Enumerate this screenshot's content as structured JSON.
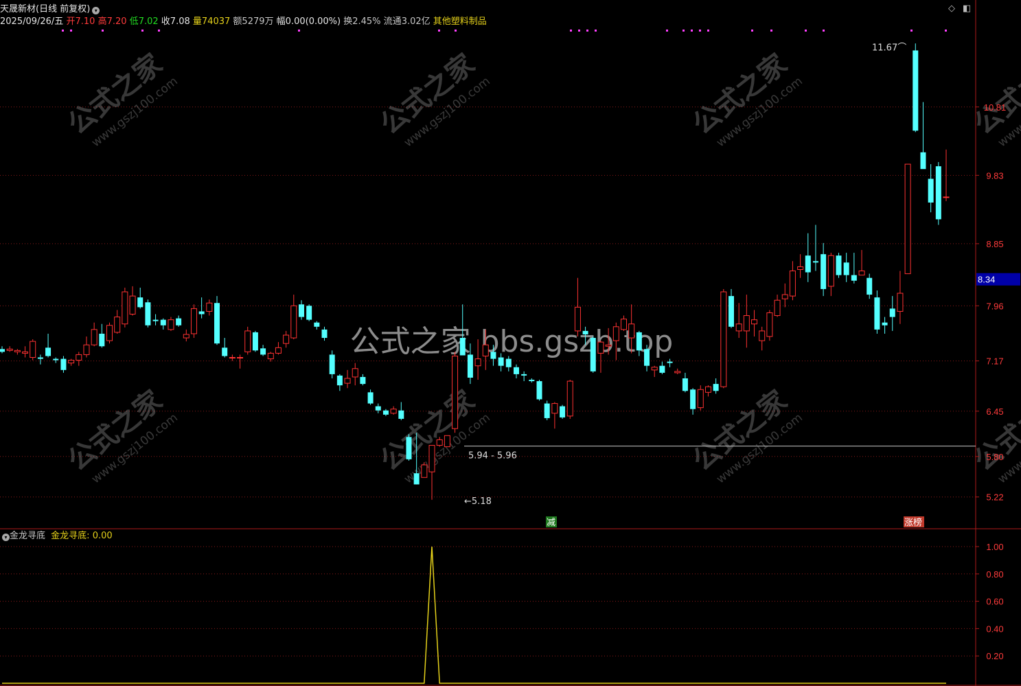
{
  "header": {
    "stock_name": "天晟新材",
    "period_label": "(日线 前复权)",
    "date": "2025/09/26/五",
    "open_label": "开",
    "open": "7.10",
    "high_label": "高",
    "high": "7.20",
    "low_label": "低",
    "low": "7.02",
    "close_label": "收",
    "close": "7.08",
    "volume_label": "量",
    "volume": "74037",
    "amount_label": "额",
    "amount": "5279万",
    "change_label": "幅",
    "change": "0.00(0.00%)",
    "turnover_label": "换",
    "turnover": "2.45%",
    "float_label": "流通",
    "float": "3.02亿",
    "sector": "其他塑料制品"
  },
  "indicator": {
    "name": "金龙寻底",
    "line_label": "金龙寻底:",
    "value": "0.00"
  },
  "watermark": {
    "center": "公式之家 bbs.gszb.top",
    "diag_cn": "公式之家",
    "diag_url": "www.gszj100.com"
  },
  "colors": {
    "up": "#ff3232",
    "down": "#54ffff",
    "grid": "#8b1a1a",
    "indicator_line": "#e6d21a",
    "price_tag_bg": "#0000a8"
  },
  "chart_data": [
    {
      "type": "candlestick",
      "title": "",
      "y_ticks": [
        10.81,
        9.83,
        8.85,
        7.96,
        7.17,
        6.45,
        5.8,
        5.22
      ],
      "y_tick_labels": [
        "10.81",
        "9.83",
        "8.85",
        "7.96",
        "7.17",
        "6.45",
        "5.80",
        "5.22"
      ],
      "current_price_tag": "8.34",
      "ylim": [
        5.05,
        11.9
      ],
      "grid": true,
      "candles": [
        [
          7.34,
          7.38,
          7.28,
          7.3
        ],
        [
          7.32,
          7.38,
          7.3,
          7.34
        ],
        [
          7.3,
          7.34,
          7.26,
          7.32
        ],
        [
          7.28,
          7.38,
          7.22,
          7.3
        ],
        [
          7.22,
          7.48,
          7.18,
          7.45
        ],
        [
          7.22,
          7.26,
          7.12,
          7.2
        ],
        [
          7.36,
          7.56,
          7.22,
          7.24
        ],
        [
          7.2,
          7.22,
          7.14,
          7.18
        ],
        [
          7.2,
          7.24,
          7.0,
          7.04
        ],
        [
          7.14,
          7.2,
          7.1,
          7.18
        ],
        [
          7.18,
          7.3,
          7.1,
          7.26
        ],
        [
          7.26,
          7.52,
          7.22,
          7.4
        ],
        [
          7.4,
          7.72,
          7.38,
          7.62
        ],
        [
          7.56,
          7.7,
          7.36,
          7.38
        ],
        [
          7.46,
          7.72,
          7.42,
          7.68
        ],
        [
          7.58,
          7.9,
          7.56,
          7.8
        ],
        [
          7.7,
          8.22,
          7.65,
          8.16
        ],
        [
          7.84,
          8.24,
          7.82,
          8.1
        ],
        [
          8.08,
          8.22,
          7.92,
          7.94
        ],
        [
          8.01,
          8.05,
          7.65,
          7.68
        ],
        [
          7.76,
          7.84,
          7.68,
          7.74
        ],
        [
          7.76,
          7.78,
          7.62,
          7.68
        ],
        [
          7.62,
          7.8,
          7.6,
          7.76
        ],
        [
          7.78,
          7.82,
          7.66,
          7.68
        ],
        [
          7.5,
          7.62,
          7.45,
          7.55
        ],
        [
          7.56,
          7.98,
          7.5,
          7.92
        ],
        [
          7.88,
          8.08,
          7.78,
          7.84
        ],
        [
          7.88,
          8.05,
          7.82,
          8.0
        ],
        [
          8.0,
          8.1,
          7.4,
          7.42
        ],
        [
          7.36,
          7.5,
          7.22,
          7.24
        ],
        [
          7.22,
          7.26,
          7.17,
          7.22
        ],
        [
          7.22,
          7.26,
          7.06,
          7.22
        ],
        [
          7.3,
          7.66,
          7.26,
          7.6
        ],
        [
          7.58,
          7.6,
          7.3,
          7.32
        ],
        [
          7.35,
          7.4,
          7.24,
          7.26
        ],
        [
          7.2,
          7.3,
          7.16,
          7.28
        ],
        [
          7.28,
          7.44,
          7.26,
          7.36
        ],
        [
          7.42,
          7.6,
          7.36,
          7.54
        ],
        [
          7.5,
          8.12,
          7.48,
          7.96
        ],
        [
          7.98,
          8.04,
          7.76,
          7.8
        ],
        [
          7.96,
          7.98,
          7.74,
          7.76
        ],
        [
          7.72,
          7.74,
          7.62,
          7.66
        ],
        [
          7.62,
          7.66,
          7.46,
          7.5
        ],
        [
          7.26,
          7.32,
          6.92,
          6.98
        ],
        [
          6.96,
          6.98,
          6.74,
          6.82
        ],
        [
          6.85,
          7.04,
          6.78,
          6.92
        ],
        [
          6.94,
          7.14,
          6.82,
          7.06
        ],
        [
          6.94,
          6.98,
          6.82,
          6.84
        ],
        [
          6.72,
          6.76,
          6.54,
          6.56
        ],
        [
          6.52,
          6.56,
          6.42,
          6.46
        ],
        [
          6.46,
          6.48,
          6.38,
          6.4
        ],
        [
          6.42,
          6.52,
          6.4,
          6.48
        ],
        [
          6.46,
          6.58,
          6.32,
          6.34
        ],
        [
          6.08,
          6.12,
          5.74,
          5.76
        ],
        [
          5.56,
          6.14,
          5.4,
          5.4
        ],
        [
          5.5,
          5.72,
          5.5,
          5.68
        ],
        [
          5.58,
          5.92,
          5.18,
          5.96
        ],
        [
          5.96,
          6.08,
          5.94,
          6.04
        ],
        [
          5.94,
          6.1,
          5.94,
          6.1
        ],
        [
          6.2,
          7.3,
          6.14,
          7.24
        ],
        [
          7.5,
          7.98,
          7.48,
          7.25
        ],
        [
          7.26,
          7.42,
          6.84,
          6.93
        ],
        [
          7.1,
          7.48,
          6.9,
          7.2
        ],
        [
          7.24,
          7.62,
          7.04,
          7.4
        ],
        [
          7.3,
          7.4,
          7.1,
          7.2
        ],
        [
          7.22,
          7.28,
          7.02,
          7.1
        ],
        [
          7.2,
          7.24,
          7.02,
          7.08
        ],
        [
          7.08,
          7.12,
          6.92,
          6.98
        ],
        [
          6.98,
          7.02,
          6.88,
          6.96
        ],
        [
          6.9,
          6.92,
          6.86,
          6.88
        ],
        [
          6.88,
          6.9,
          6.6,
          6.62
        ],
        [
          6.56,
          6.6,
          6.32,
          6.35
        ],
        [
          6.42,
          6.58,
          6.2,
          6.56
        ],
        [
          6.52,
          6.54,
          6.34,
          6.36
        ],
        [
          6.38,
          6.9,
          6.34,
          6.88
        ],
        [
          7.6,
          8.36,
          7.52,
          7.94
        ],
        [
          7.6,
          7.66,
          7.4,
          7.55
        ],
        [
          7.5,
          7.52,
          7.0,
          7.02
        ],
        [
          7.28,
          7.46,
          7.0,
          7.44
        ],
        [
          7.38,
          7.64,
          7.26,
          7.4
        ],
        [
          7.46,
          7.72,
          7.18,
          7.66
        ],
        [
          7.62,
          7.82,
          7.6,
          7.77
        ],
        [
          7.5,
          7.98,
          7.28,
          7.7
        ],
        [
          7.58,
          7.6,
          7.24,
          7.32
        ],
        [
          7.34,
          7.4,
          7.02,
          7.1
        ],
        [
          7.04,
          7.1,
          6.94,
          7.08
        ],
        [
          7.1,
          7.16,
          6.98,
          7.0
        ],
        [
          7.16,
          7.2,
          7.08,
          7.14
        ],
        [
          7.0,
          7.06,
          6.98,
          7.02
        ],
        [
          6.92,
          7.0,
          6.72,
          6.74
        ],
        [
          6.76,
          6.78,
          6.4,
          6.48
        ],
        [
          6.5,
          6.82,
          6.46,
          6.76
        ],
        [
          6.72,
          6.82,
          6.66,
          6.8
        ],
        [
          6.84,
          6.92,
          6.7,
          6.74
        ],
        [
          6.8,
          8.2,
          6.78,
          8.16
        ],
        [
          8.1,
          8.2,
          7.64,
          7.66
        ],
        [
          7.6,
          8.0,
          7.5,
          7.7
        ],
        [
          7.6,
          8.12,
          7.36,
          7.82
        ],
        [
          7.7,
          7.9,
          7.52,
          7.76
        ],
        [
          7.46,
          7.66,
          7.32,
          7.6
        ],
        [
          7.52,
          7.9,
          7.46,
          7.86
        ],
        [
          7.82,
          8.12,
          7.8,
          8.04
        ],
        [
          8.06,
          8.28,
          7.94,
          8.12
        ],
        [
          8.1,
          8.6,
          8.04,
          8.46
        ],
        [
          8.48,
          8.7,
          8.36,
          8.52
        ],
        [
          8.68,
          9.0,
          8.3,
          8.44
        ],
        [
          8.6,
          9.12,
          8.46,
          8.58
        ],
        [
          8.7,
          8.86,
          8.1,
          8.2
        ],
        [
          8.24,
          8.72,
          8.1,
          8.68
        ],
        [
          8.68,
          8.72,
          8.36,
          8.4
        ],
        [
          8.58,
          8.72,
          8.3,
          8.4
        ],
        [
          8.4,
          8.72,
          8.28,
          8.32
        ],
        [
          8.4,
          8.76,
          8.4,
          8.46
        ],
        [
          8.36,
          8.42,
          8.06,
          8.12
        ],
        [
          8.08,
          8.18,
          7.56,
          7.62
        ],
        [
          7.72,
          7.8,
          7.56,
          7.68
        ],
        [
          7.92,
          8.1,
          7.6,
          7.8
        ],
        [
          7.88,
          8.46,
          7.7,
          8.14
        ],
        [
          8.42,
          9.7,
          8.42,
          9.99
        ],
        [
          11.62,
          11.72,
          10.45,
          10.47
        ],
        [
          10.16,
          10.88,
          9.99,
          9.92
        ],
        [
          9.78,
          9.99,
          9.3,
          9.44
        ],
        [
          9.96,
          10.02,
          9.12,
          9.2
        ],
        [
          9.52,
          10.2,
          9.46,
          9.52
        ]
      ],
      "annotations": {
        "max_label": "11.67",
        "min_label": "5.18",
        "range_label": "5.94 - 5.96",
        "range_level": 5.94,
        "badges": [
          "减",
          "涨榜"
        ]
      }
    },
    {
      "type": "line",
      "name": "金龙寻底",
      "y_ticks": [
        1.0,
        0.8,
        0.6,
        0.4,
        0.2
      ],
      "y_tick_labels": [
        "1.00",
        "0.80",
        "0.60",
        "0.40",
        "0.20"
      ],
      "ylim": [
        0,
        1.0
      ],
      "spike_index": 56,
      "values_note_count": 124
    }
  ]
}
